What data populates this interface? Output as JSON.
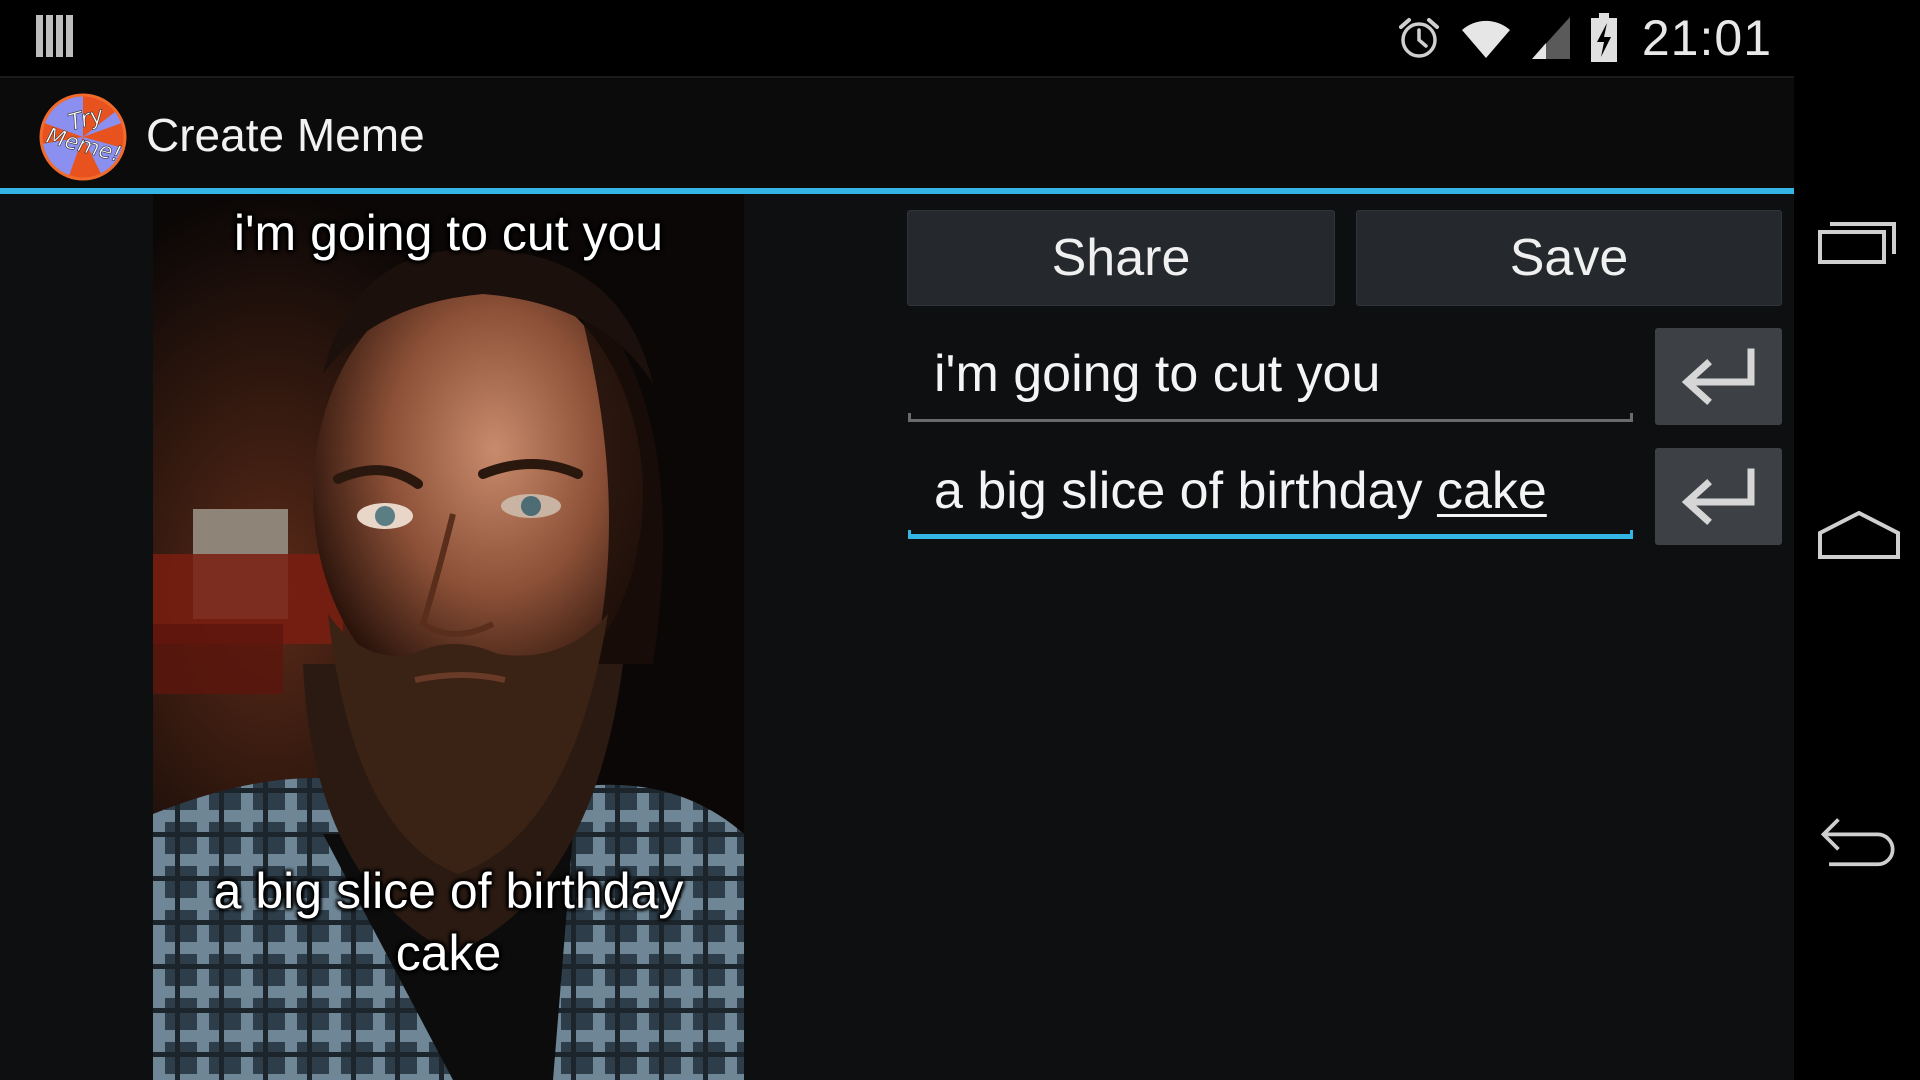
{
  "status_bar": {
    "time": "21:01",
    "icons": [
      "notification-bars-icon",
      "alarm-icon",
      "wifi-icon",
      "signal-icon",
      "battery-charging-icon"
    ]
  },
  "action_bar": {
    "logo_text_line1": "Try",
    "logo_text_line2": "Meme!",
    "title": "Create Meme"
  },
  "meme": {
    "top_text": "i'm going to cut you",
    "bottom_text": "a big slice of birthday cake"
  },
  "buttons": {
    "share_label": "Share",
    "save_label": "Save"
  },
  "inputs": {
    "top_text_value": "i'm going to cut you",
    "bottom_text_prefix": "a big slice of birthday ",
    "bottom_text_composing": "cake"
  },
  "navigation": [
    "recents-icon",
    "home-icon",
    "back-icon"
  ],
  "colors": {
    "accent": "#33b5e5",
    "background": "#0d0f11",
    "button": "#25292d",
    "enter_button": "#3d4145"
  }
}
